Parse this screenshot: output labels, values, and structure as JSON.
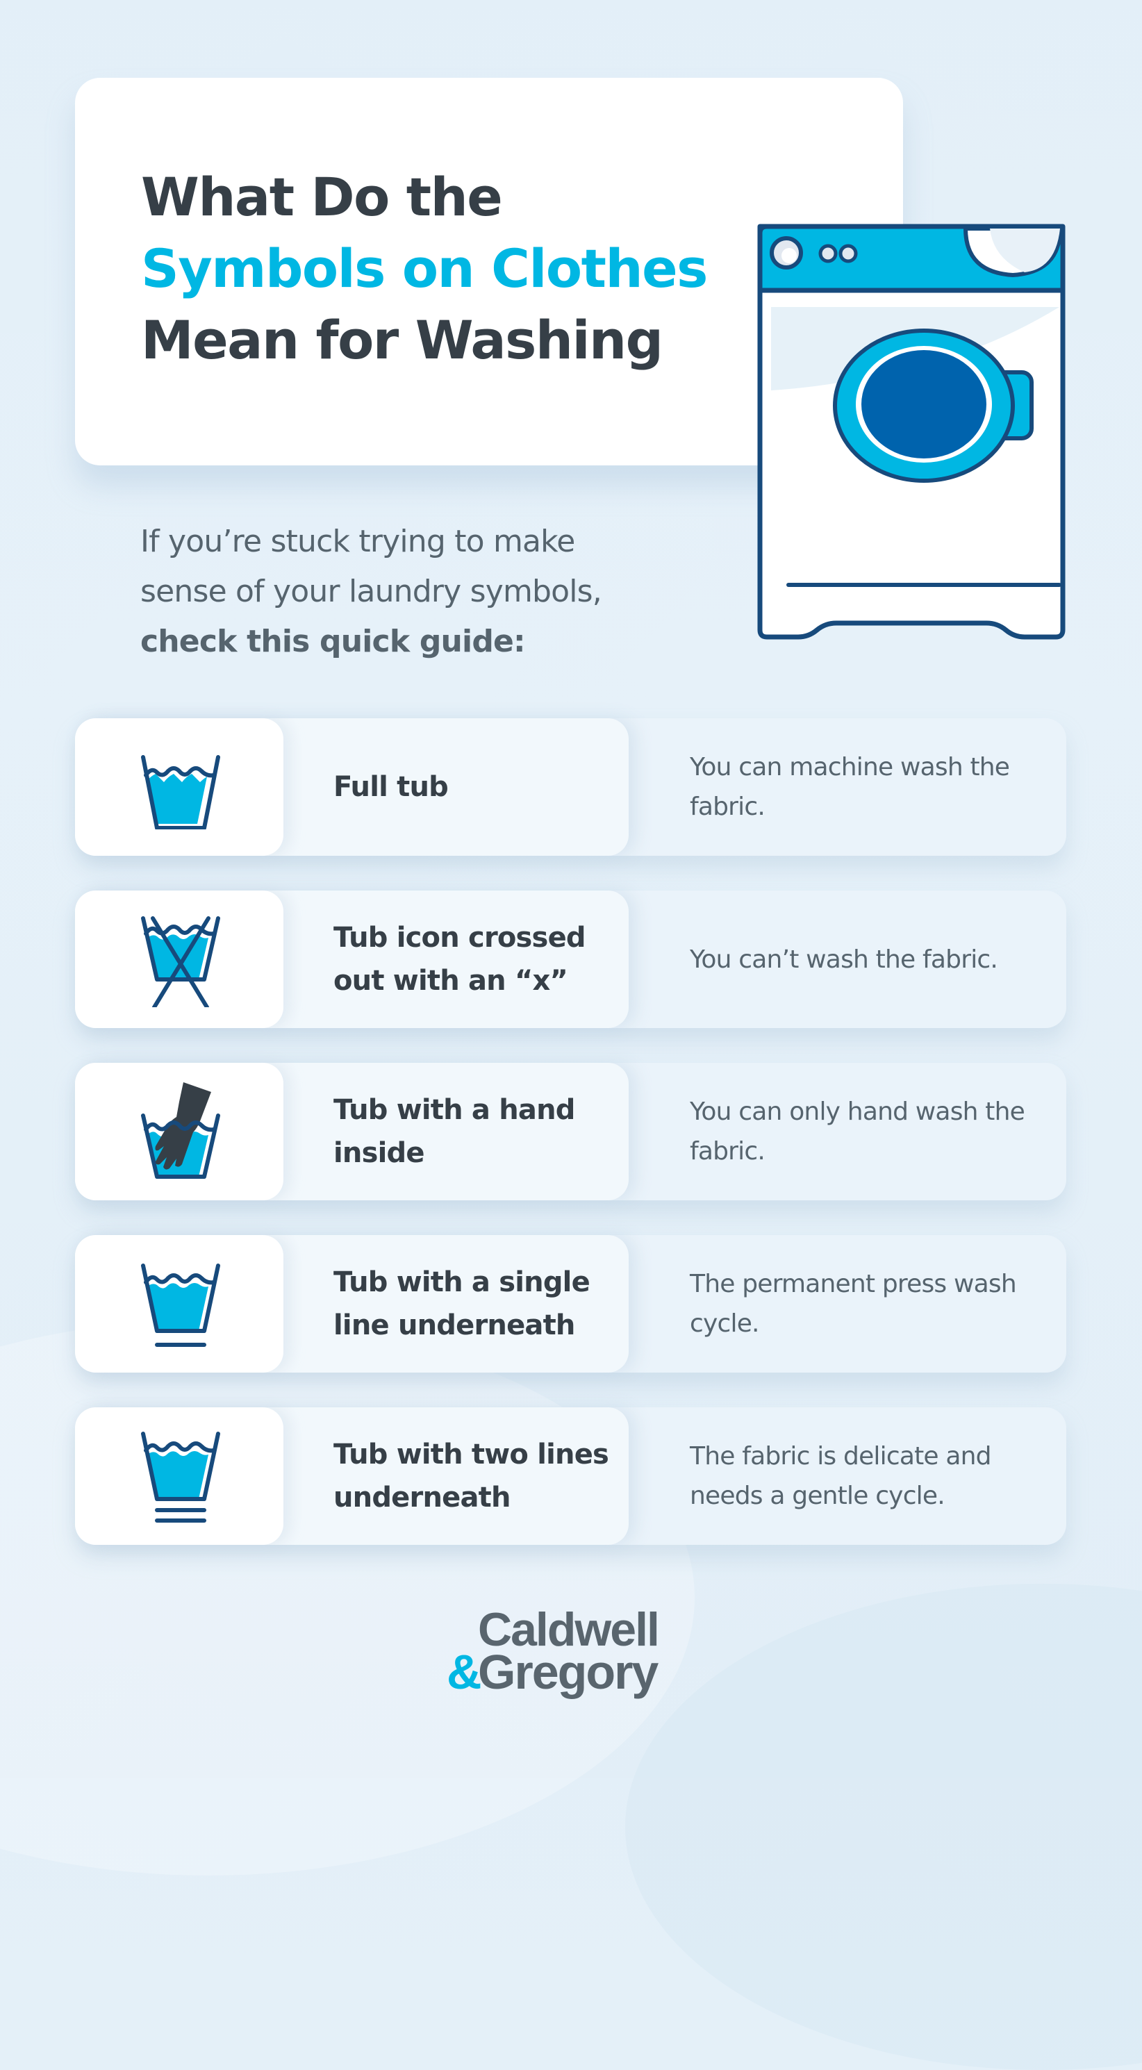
{
  "title": {
    "line1": "What Do the",
    "line2": "Symbols on Clothes",
    "line3": "Mean for Washing"
  },
  "intro": {
    "line1": "If you’re stuck trying to make",
    "line2": "sense of your laundry symbols,",
    "line3_bold": "check this quick guide:"
  },
  "colors": {
    "accent": "#00b7e3",
    "navy": "#174a7c",
    "dark_text": "#363f47",
    "body_text": "#56646e",
    "drum": "#0063ad"
  },
  "symbols": [
    {
      "icon": "full-tub-icon",
      "label": "Full tub",
      "description": "You can machine wash the fabric."
    },
    {
      "icon": "crossed-tub-icon",
      "label": "Tub icon crossed out with an “x”",
      "description": "You can’t wash the fabric."
    },
    {
      "icon": "hand-wash-tub-icon",
      "label": "Tub with a hand inside",
      "description": "You can only hand wash the fabric."
    },
    {
      "icon": "tub-single-line-icon",
      "label": "Tub with a single line underneath",
      "description": "The permanent press wash cycle."
    },
    {
      "icon": "tub-two-lines-icon",
      "label": "Tub with two lines underneath",
      "description": "The fabric is delicate and needs a gentle cycle."
    }
  ],
  "logo": {
    "line1": "Caldwell",
    "ampersand": "&",
    "line2": "Gregory"
  }
}
